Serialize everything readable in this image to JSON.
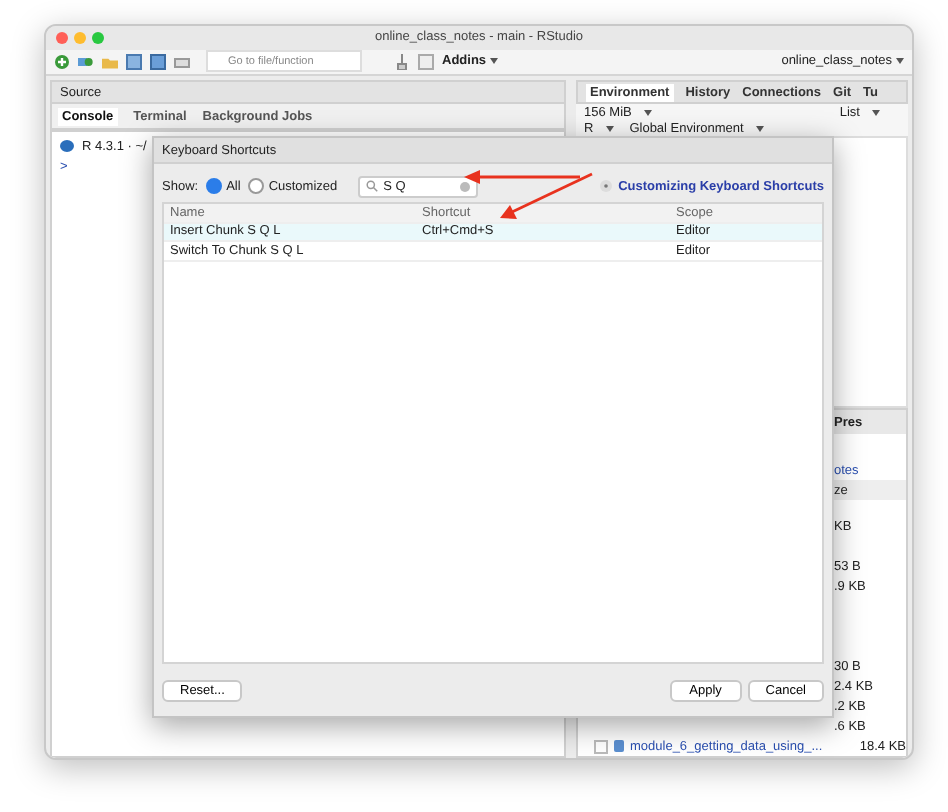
{
  "window": {
    "title": "online_class_notes - main - RStudio"
  },
  "toolbar": {
    "goto_placeholder": "Go to file/function",
    "addins": "Addins",
    "project": "online_class_notes"
  },
  "source_pane": {
    "title": "Source"
  },
  "console_pane": {
    "tabs": [
      {
        "label": "Console",
        "selected": true
      },
      {
        "label": "Terminal",
        "selected": false
      },
      {
        "label": "Background Jobs",
        "selected": false
      }
    ],
    "version": "R 4.3.1 · ~/",
    "prompt": ">"
  },
  "environment_pane": {
    "tabs": [
      {
        "label": "Environment",
        "selected": true
      },
      {
        "label": "History",
        "selected": false
      },
      {
        "label": "Connections",
        "selected": false
      },
      {
        "label": "Git",
        "selected": false
      },
      {
        "label": "Tu",
        "selected": false
      }
    ],
    "memory": "156 MiB",
    "view": "List",
    "language": "R",
    "scope": "Global Environment"
  },
  "files_pane": {
    "tab": "Pres",
    "path": "otes",
    "column": "ze",
    "size_groups": [
      [
        "KB"
      ],
      [
        "53 B",
        ".9 KB"
      ],
      [
        "30 B",
        "2.4 KB",
        ".2 KB",
        ".6 KB"
      ]
    ],
    "rows": [
      {
        "name": "module_6_getting_data_using_...",
        "size": "18.4 KB",
        "checked": false
      }
    ]
  },
  "dialog": {
    "title": "Keyboard Shortcuts",
    "show_label": "Show:",
    "filters": [
      {
        "label": "All",
        "selected": true
      },
      {
        "label": "Customized",
        "selected": false
      }
    ],
    "search": {
      "value": "S Q"
    },
    "help_link": "Customizing Keyboard Shortcuts",
    "columns": [
      "Name",
      "Shortcut",
      "Scope"
    ],
    "rows": [
      {
        "name": "Insert Chunk S Q L",
        "shortcut": "Ctrl+Cmd+S",
        "scope": "Editor",
        "selected": true
      },
      {
        "name": "Switch To Chunk S Q L",
        "scope": "Editor",
        "selected": false
      }
    ],
    "buttons_left": [
      "Reset..."
    ],
    "buttons_right": [
      "Apply",
      "Cancel"
    ]
  }
}
